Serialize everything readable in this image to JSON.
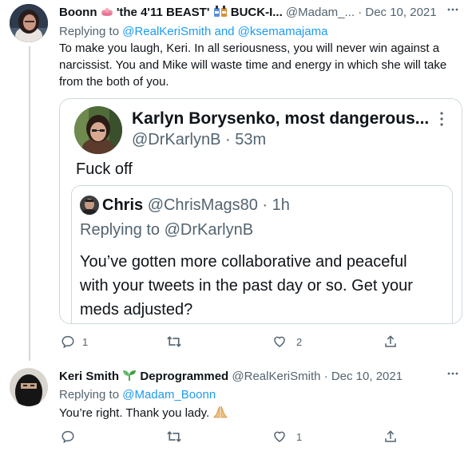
{
  "tweet1": {
    "display_name": "Boonn",
    "name_suffix": "'the 4'11 BEAST'",
    "name_suffix2": "BUCK-I...",
    "handle": "@Madam_...",
    "separator": "·",
    "date": "Dec 10, 2021",
    "replying_prefix": "Replying to",
    "replying_to": "@RealKeriSmith and @ksemamajama",
    "text": "To make you laugh, Keri. In all seriousness, you will never win against a narcissist. You and Mike will waste time and energy in which she will take from the both of you.",
    "quote": {
      "display_name": "Karlyn Borysenko, most dangerous...",
      "handle": "@DrKarlynB",
      "separator": "·",
      "time": "53m",
      "text": "Fuck off",
      "inner_quote": {
        "display_name": "Chris",
        "handle": "@ChrisMags80",
        "separator": "·",
        "time": "1h",
        "replying_prefix": "Replying to",
        "replying_to": "@DrKarlynB",
        "text": "You’ve gotten more collaborative and peaceful with your tweets in the past day or so. Get your meds adjusted?"
      }
    },
    "actions": {
      "reply_count": "1",
      "retweet_count": "",
      "like_count": "2"
    }
  },
  "tweet2": {
    "display_name": "Keri Smith",
    "name_suffix": "Deprogrammed",
    "handle": "@RealKeriSmith",
    "separator": "·",
    "date": "Dec 10, 2021",
    "replying_prefix": "Replying to",
    "replying_to": "@Madam_Boonn",
    "text": "You’re right. Thank you lady.",
    "actions": {
      "reply_count": "",
      "retweet_count": "",
      "like_count": "1"
    }
  },
  "icons": {
    "more": "more-horizontal-icon",
    "reply": "reply-icon",
    "retweet": "retweet-icon",
    "like": "heart-icon",
    "share": "share-icon",
    "flower": "lotus-flower-emoji",
    "bottles": "bottles-emoji",
    "seedling": "seedling-emoji",
    "praying": "praying-hands-emoji"
  },
  "colors": {
    "link": "#1d9bf0",
    "muted": "#536471",
    "border": "#cfd9de",
    "text": "#0f1419"
  }
}
